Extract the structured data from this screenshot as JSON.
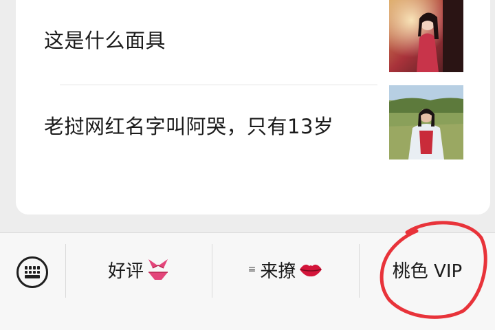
{
  "articles": [
    {
      "title": "这是什么面具",
      "thumbnail": "portrait-photo"
    },
    {
      "title": "老挝网红名字叫阿哭，只有13岁",
      "thumbnail": "outdoor-photo"
    }
  ],
  "menu": {
    "items": [
      {
        "label": "好评",
        "icon": "bikini-emoji"
      },
      {
        "label": "来撩",
        "icon": "lips-emoji",
        "submenu_glyph": "≡"
      },
      {
        "label": "桃色 VIP"
      }
    ]
  },
  "colors": {
    "background": "#ededed",
    "card": "#ffffff",
    "menu_bar": "#f7f7f7",
    "annotation": "#e8333a"
  }
}
